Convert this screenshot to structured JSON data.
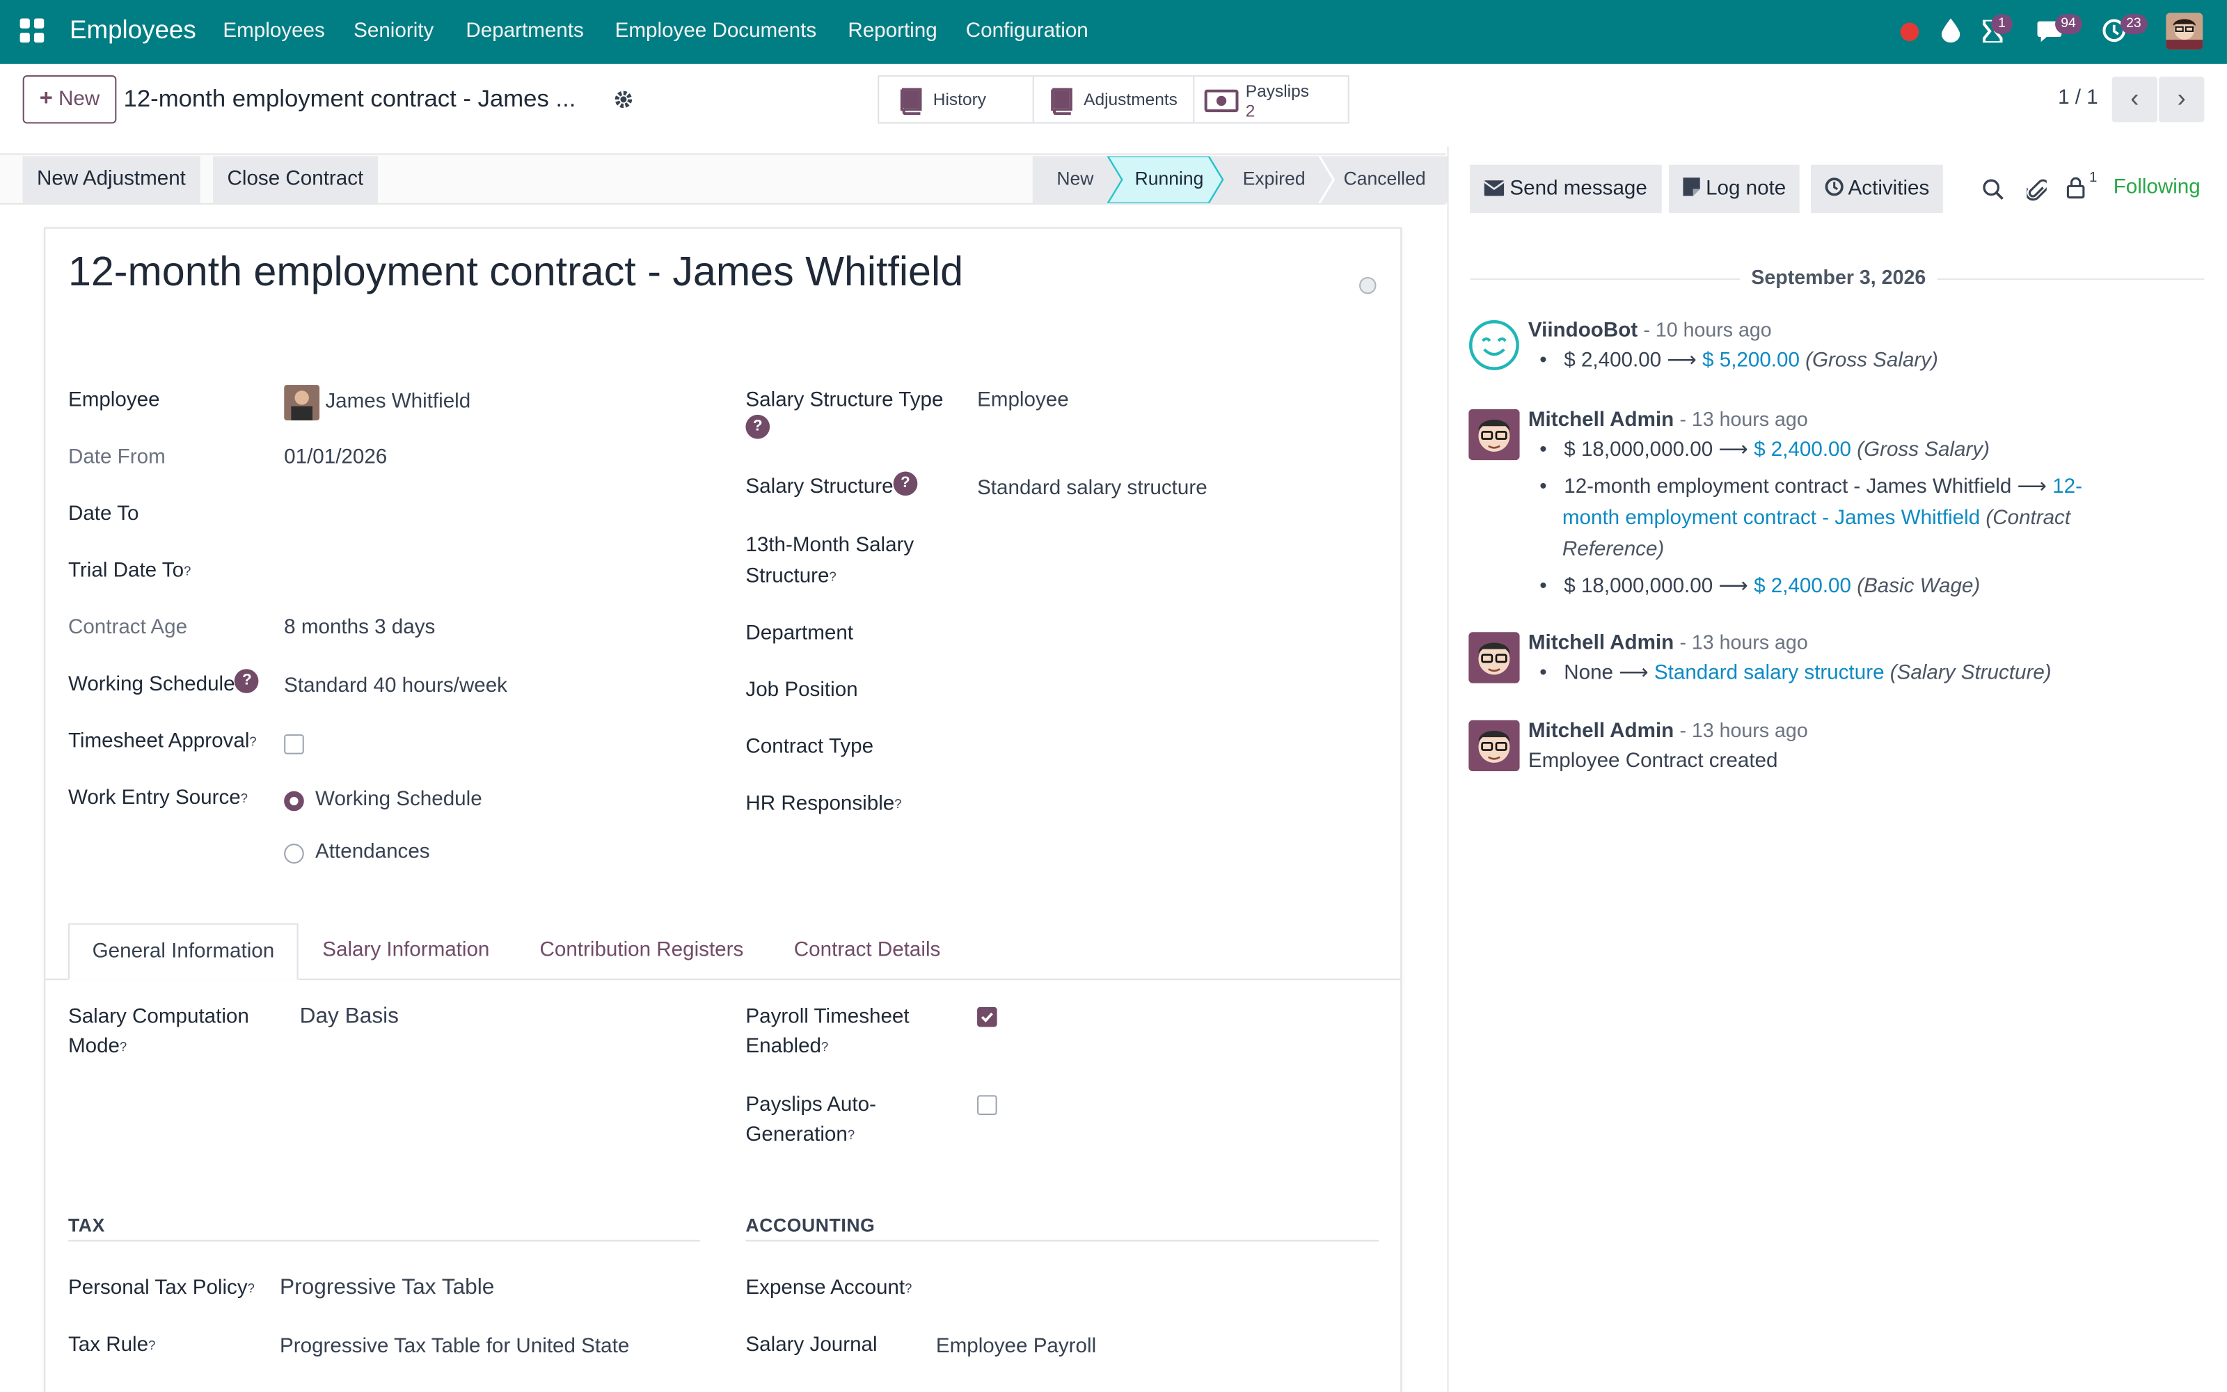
{
  "navbar": {
    "app_name": "Employees",
    "menus": [
      "Employees",
      "Seniority",
      "Departments",
      "Employee Documents",
      "Reporting",
      "Configuration"
    ],
    "badges": {
      "activities": "1",
      "messages": "94",
      "clock": "23"
    }
  },
  "control": {
    "new_label": "New",
    "breadcrumb": "12-month employment contract - James ...",
    "smart_buttons": {
      "history": "History",
      "adjustments": "Adjustments",
      "payslips": "Payslips",
      "payslips_count": "2"
    },
    "pager": "1 / 1"
  },
  "statusbar": {
    "buttons": {
      "new_adjustment": "New Adjustment",
      "close_contract": "Close Contract"
    },
    "stages": [
      "New",
      "Running",
      "Expired",
      "Cancelled"
    ],
    "active_stage": "Running"
  },
  "form": {
    "title": "12-month employment contract - James Whitfield",
    "left": {
      "employee_label": "Employee",
      "employee_value": "James Whitfield",
      "date_from_label": "Date From",
      "date_from_value": "01/01/2026",
      "date_to_label": "Date To",
      "trial_label": "Trial Date To",
      "age_label": "Contract Age",
      "age_value": "8 months 3 days",
      "schedule_label": "Working Schedule",
      "schedule_value": "Standard 40 hours/week",
      "timesheet_label": "Timesheet Approval",
      "work_entry_label": "Work Entry Source",
      "work_entry_options": [
        "Working Schedule",
        "Attendances"
      ],
      "work_entry_selected": "Working Schedule"
    },
    "right": {
      "struct_type_label": "Salary Structure Type",
      "struct_type_value": "Employee",
      "struct_label": "Salary Structure",
      "struct_value": "Standard salary structure",
      "thirteenth_label_1": "13th-Month Salary",
      "thirteenth_label_2": "Structure",
      "department_label": "Department",
      "job_label": "Job Position",
      "contract_type_label": "Contract Type",
      "hr_label": "HR Responsible"
    },
    "tabs": [
      "General Information",
      "Salary Information",
      "Contribution Registers",
      "Contract Details"
    ],
    "active_tab": "General Information",
    "general": {
      "comp_label_1": "Salary Computation",
      "comp_label_2": "Mode",
      "comp_value": "Day Basis",
      "payroll_ts_label_1": "Payroll Timesheet",
      "payroll_ts_label_2": "Enabled",
      "payroll_ts_checked": true,
      "auto_gen_label_1": "Payslips Auto-",
      "auto_gen_label_2": "Generation",
      "auto_gen_checked": false,
      "tax_section": "TAX",
      "accounting_section": "ACCOUNTING",
      "tax_policy_label": "Personal Tax Policy",
      "tax_policy_value": "Progressive Tax Table",
      "tax_rule_label": "Tax Rule",
      "tax_rule_value": "Progressive Tax Table for United State",
      "expense_label": "Expense Account",
      "journal_label": "Salary Journal",
      "journal_value": "Employee Payroll"
    }
  },
  "chatter": {
    "send_message": "Send message",
    "log_note": "Log note",
    "activities": "Activities",
    "followers_count": "1",
    "following": "Following",
    "date_separator": "September 3, 2026",
    "messages": [
      {
        "author": "ViindooBot",
        "ago": "- 10 hours ago",
        "lines": [
          {
            "old": "$ 2,400.00",
            "new": "$ 5,200.00",
            "field": "(Gross Salary)"
          }
        ]
      },
      {
        "author": "Mitchell Admin",
        "ago": "- 13 hours ago",
        "lines": [
          {
            "old": "$ 18,000,000.00",
            "new": "$ 2,400.00",
            "field": "(Gross Salary)"
          },
          {
            "old": "12-month employment contract - James Whitfield",
            "new_1": "12-",
            "new_2": "month employment contract - James Whitfield",
            "field_1": "(Contract",
            "field_2": "Reference)"
          },
          {
            "old": "$ 18,000,000.00",
            "new": "$ 2,400.00",
            "field": "(Basic Wage)"
          }
        ]
      },
      {
        "author": "Mitchell Admin",
        "ago": "- 13 hours ago",
        "lines": [
          {
            "old": "None",
            "new": "Standard salary structure",
            "field": "(Salary Structure)"
          }
        ]
      },
      {
        "author": "Mitchell Admin",
        "ago": "- 13 hours ago",
        "body": "Employee Contract created"
      }
    ]
  }
}
